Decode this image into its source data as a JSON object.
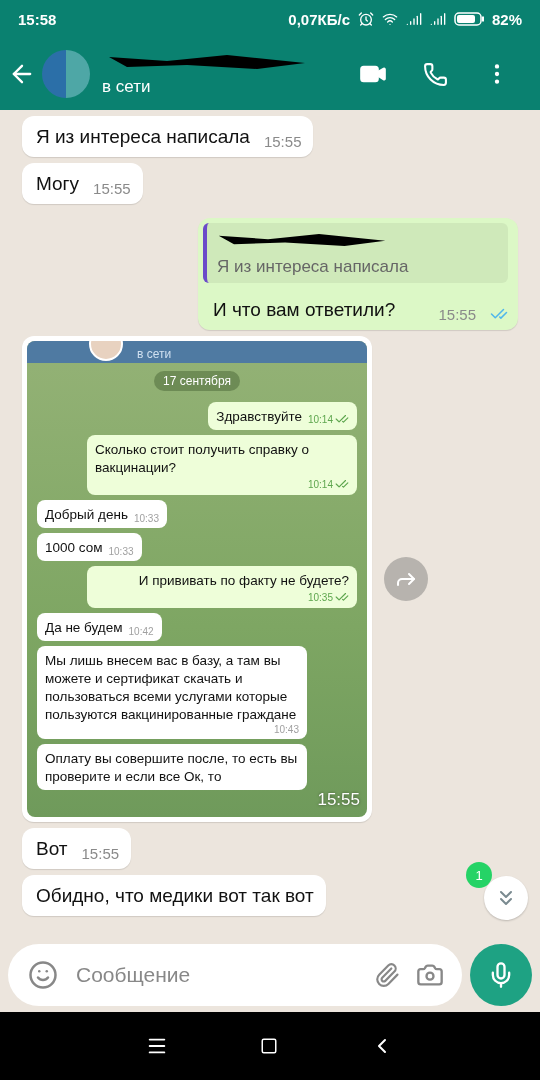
{
  "status_bar": {
    "time": "15:58",
    "speed": "0,07КБ/с",
    "battery": "82%"
  },
  "header": {
    "status": "в сети"
  },
  "messages": [
    {
      "kind": "text",
      "outgoing": false,
      "text": "Я из интереса написала",
      "time": "15:55"
    },
    {
      "kind": "text",
      "outgoing": false,
      "text": "Могу",
      "time": "15:55"
    },
    {
      "kind": "reply",
      "outgoing": true,
      "quote": "Я из интереса написала",
      "text": "И что вам ответили?",
      "time": "15:55",
      "read": true
    },
    {
      "kind": "image",
      "outgoing": false,
      "time": "15:55",
      "screenshot": {
        "status": "в сети",
        "date": "17 сентября",
        "messages": [
          {
            "outgoing": true,
            "text": "Здравствуйте",
            "time": "10:14"
          },
          {
            "outgoing": true,
            "text": "Сколько стоит получить справку о вакцинации?",
            "time": "10:14"
          },
          {
            "outgoing": false,
            "text": "Добрый день",
            "time": "10:33"
          },
          {
            "outgoing": false,
            "text": "1000 сом",
            "time": "10:33"
          },
          {
            "outgoing": true,
            "text": "И прививать по факту не будете?",
            "time": "10:35"
          },
          {
            "outgoing": false,
            "text": "Да не будем",
            "time": "10:42"
          },
          {
            "outgoing": false,
            "text": "Мы лишь внесем вас в базу, а там вы можете и сертификат скачать и пользоваться всеми услугами которые пользуются вакцинированные граждане",
            "time": "10:43"
          },
          {
            "outgoing": false,
            "text": "Оплату вы совершите после, то есть вы проверите и если все Ок, то"
          }
        ]
      }
    },
    {
      "kind": "text",
      "outgoing": false,
      "text": "Вот",
      "time": "15:55"
    },
    {
      "kind": "text",
      "outgoing": false,
      "text": "Обидно, что медики вот так вот"
    }
  ],
  "unread_badge": "1",
  "composer": {
    "placeholder": "Сообщение"
  }
}
